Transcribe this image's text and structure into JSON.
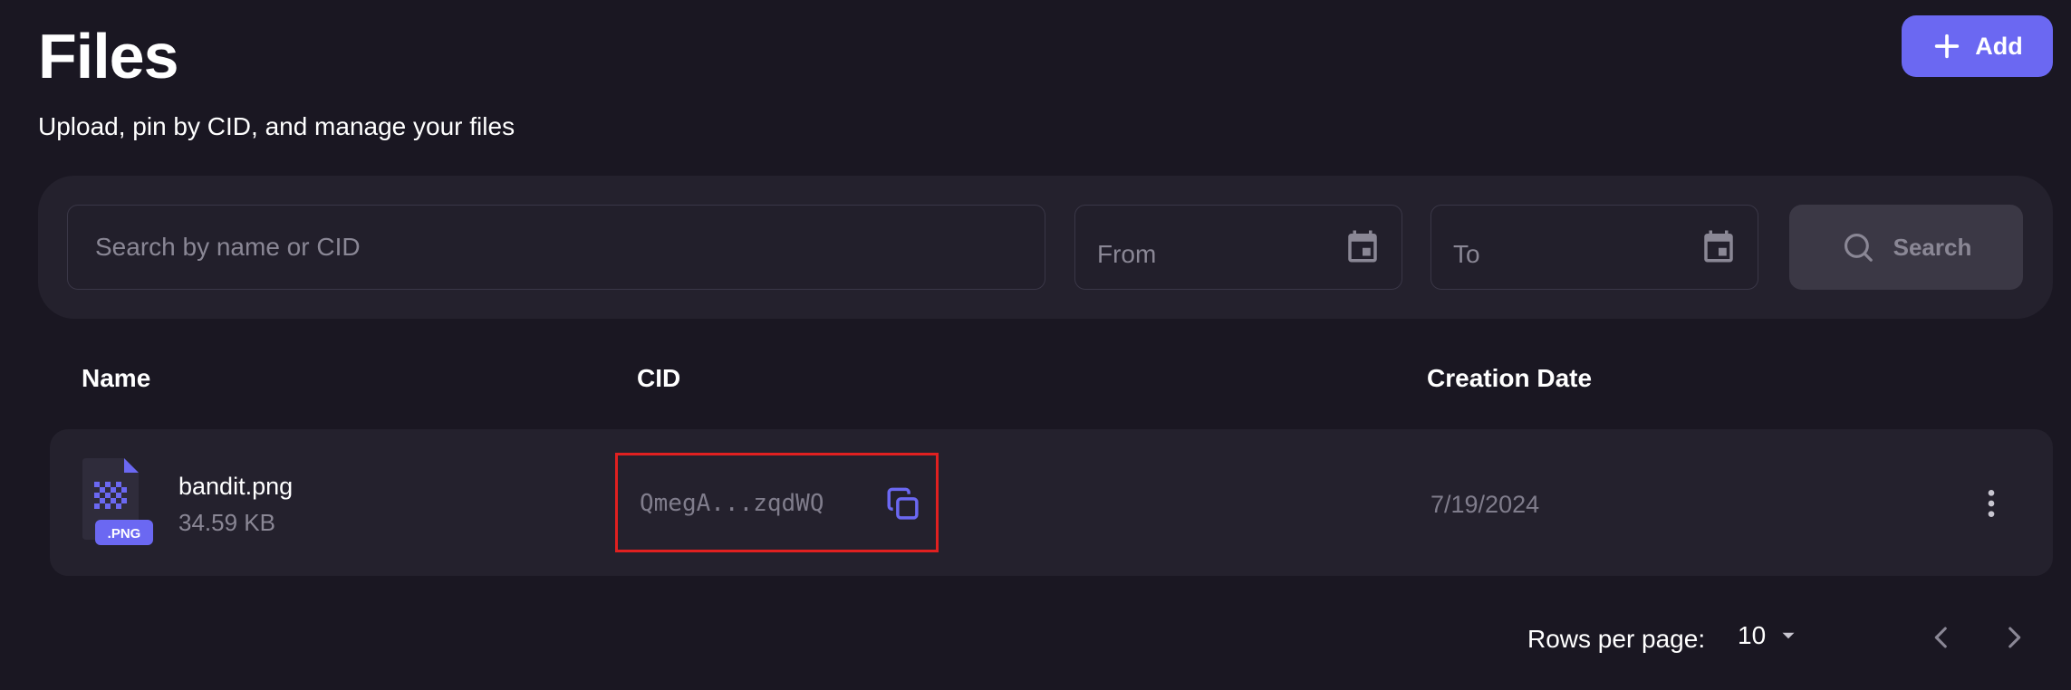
{
  "header": {
    "title": "Files",
    "subtitle": "Upload, pin by CID, and manage your files",
    "add_label": "Add"
  },
  "filters": {
    "search_placeholder": "Search by name or CID",
    "search_value": "",
    "from_placeholder": "From",
    "to_placeholder": "To",
    "search_button_label": "Search"
  },
  "table": {
    "columns": [
      "Name",
      "CID",
      "Creation Date"
    ],
    "rows": [
      {
        "file_type_badge": ".PNG",
        "name": "bandit.png",
        "size": "34.59 KB",
        "cid": "QmegA...zqdWQ",
        "creation_date": "7/19/2024"
      }
    ]
  },
  "pagination": {
    "rows_per_page_label": "Rows per page:",
    "rows_per_page_value": "10"
  },
  "colors": {
    "accent": "#6b68f2",
    "background": "#1a1722",
    "panel": "#24212d",
    "highlight": "#e02020"
  },
  "icons": [
    "plus-icon",
    "calendar-icon",
    "search-icon",
    "file-image-icon",
    "copy-icon",
    "more-vertical-icon",
    "chevron-down-icon",
    "chevron-left-icon",
    "chevron-right-icon"
  ]
}
